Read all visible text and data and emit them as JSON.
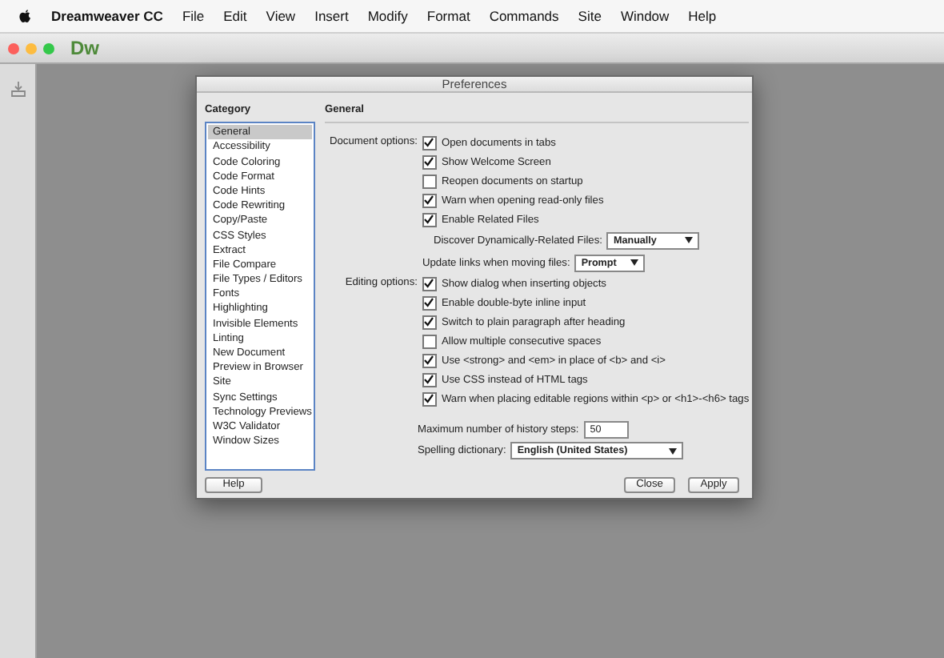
{
  "menu_bar": {
    "app_name": "Dreamweaver CC",
    "items": [
      "File",
      "Edit",
      "View",
      "Insert",
      "Modify",
      "Format",
      "Commands",
      "Site",
      "Window",
      "Help"
    ]
  },
  "app_window": {
    "logo": "Dw"
  },
  "dialog": {
    "title": "Preferences",
    "category_heading": "Category",
    "categories": [
      {
        "label": "General",
        "selected": true
      },
      {
        "label": "Accessibility",
        "selected": false
      },
      {
        "label": "Code Coloring",
        "selected": false
      },
      {
        "label": "Code Format",
        "selected": false
      },
      {
        "label": "Code Hints",
        "selected": false
      },
      {
        "label": "Code Rewriting",
        "selected": false
      },
      {
        "label": "Copy/Paste",
        "selected": false
      },
      {
        "label": "CSS Styles",
        "selected": false
      },
      {
        "label": "Extract",
        "selected": false
      },
      {
        "label": "File Compare",
        "selected": false
      },
      {
        "label": "File Types / Editors",
        "selected": false
      },
      {
        "label": "Fonts",
        "selected": false
      },
      {
        "label": "Highlighting",
        "selected": false
      },
      {
        "label": "Invisible Elements",
        "selected": false
      },
      {
        "label": "Linting",
        "selected": false
      },
      {
        "label": "New Document",
        "selected": false
      },
      {
        "label": "Preview in Browser",
        "selected": false
      },
      {
        "label": "Site",
        "selected": false
      },
      {
        "label": "Sync Settings",
        "selected": false
      },
      {
        "label": "Technology Previews",
        "selected": false
      },
      {
        "label": "W3C Validator",
        "selected": false
      },
      {
        "label": "Window Sizes",
        "selected": false
      }
    ],
    "section_title": "General",
    "groups": [
      {
        "label": "Document options:",
        "options": [
          {
            "kind": "checkbox",
            "label": "Open documents in tabs",
            "checked": true
          },
          {
            "kind": "checkbox",
            "label": "Show Welcome Screen",
            "checked": true
          },
          {
            "kind": "checkbox",
            "label": "Reopen documents on startup",
            "checked": false
          },
          {
            "kind": "checkbox",
            "label": "Warn when opening read-only files",
            "checked": true
          },
          {
            "kind": "checkbox",
            "label": "Enable Related Files",
            "checked": true
          },
          {
            "kind": "select",
            "label": "Discover Dynamically-Related Files:",
            "value": "Manually"
          },
          {
            "kind": "select",
            "label": "Update links when moving files:",
            "value": "Prompt"
          }
        ]
      },
      {
        "label": "Editing options:",
        "options": [
          {
            "kind": "checkbox",
            "label": "Show dialog when inserting objects",
            "checked": true
          },
          {
            "kind": "checkbox",
            "label": "Enable double-byte inline input",
            "checked": true
          },
          {
            "kind": "checkbox",
            "label": "Switch to plain paragraph after heading",
            "checked": true
          },
          {
            "kind": "checkbox",
            "label": "Allow multiple consecutive spaces",
            "checked": false
          },
          {
            "kind": "checkbox",
            "label": "Use <strong> and <em> in place of <b> and <i>",
            "checked": true
          },
          {
            "kind": "checkbox",
            "label": "Use CSS instead of HTML tags",
            "checked": true
          },
          {
            "kind": "checkbox",
            "label": "Warn when placing editable regions within <p> or <h1>-<h6> tags",
            "checked": true
          }
        ]
      }
    ],
    "history": {
      "label": "Maximum number of history steps:",
      "value": "50"
    },
    "spelling": {
      "label": "Spelling dictionary:",
      "value": "English (United States)"
    },
    "buttons": {
      "help": "Help",
      "close": "Close",
      "apply": "Apply"
    }
  }
}
